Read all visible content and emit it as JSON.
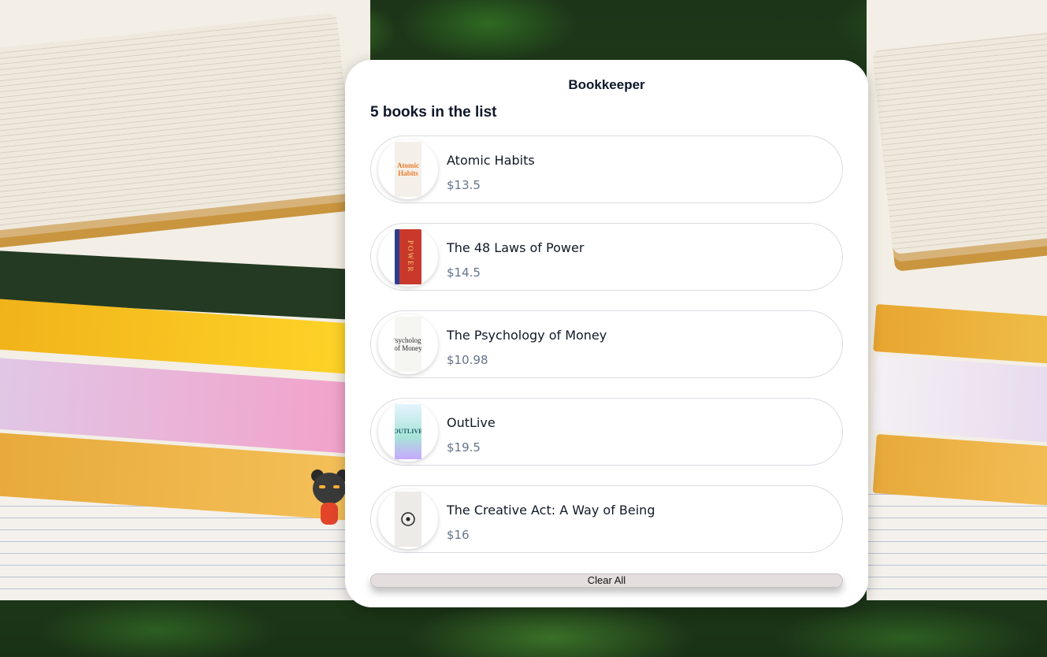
{
  "app": {
    "title": "Bookkeeper"
  },
  "summary": {
    "count_text": "5 books in the list"
  },
  "books": [
    {
      "name": "Atomic Habits",
      "price": "$13.5",
      "cover_text": "Atomic Habits"
    },
    {
      "name": "The 48 Laws of Power",
      "price": "$14.5",
      "cover_text": "POWER"
    },
    {
      "name": "The Psychology of Money",
      "price": "$10.98",
      "cover_text": "Psychology of Money"
    },
    {
      "name": "OutLive",
      "price": "$19.5",
      "cover_text": "OUTLIVE"
    },
    {
      "name": "The Creative Act: A Way of Being",
      "price": "$16",
      "cover_text": ""
    }
  ],
  "actions": {
    "clear_all": "Clear All"
  },
  "colors": {
    "card_bg": "#ffffff",
    "price": "#64748b",
    "button_bg": "#e5dedf"
  }
}
